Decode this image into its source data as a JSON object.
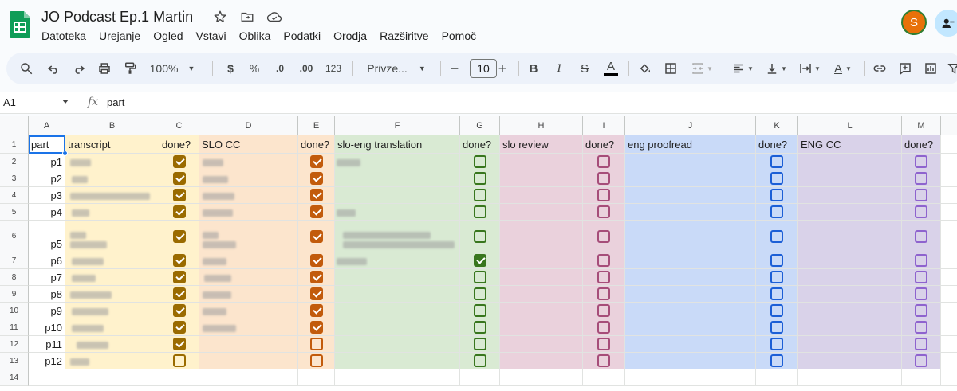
{
  "app": {
    "title": "JO Podcast Ep.1 Martin",
    "menu": [
      "Datoteka",
      "Urejanje",
      "Ogled",
      "Vstavi",
      "Oblika",
      "Podatki",
      "Orodja",
      "Razširitve",
      "Pomoč"
    ],
    "avatar_letter": "S"
  },
  "toolbar": {
    "zoom": "100%",
    "currency": "$",
    "percent": "%",
    "dec_less": ".0",
    "dec_more": ".00",
    "format_123": "123",
    "font": "Privze...",
    "font_size": "10",
    "minus": "−",
    "plus": "+",
    "bold": "B",
    "italic": "I",
    "strike": "S",
    "text_color_letter": "A",
    "text_color_letter2": "A"
  },
  "formula_bar": {
    "name_box": "A1",
    "fx": "fx",
    "value": "part"
  },
  "columns": [
    {
      "letter": "A",
      "width": 46
    },
    {
      "letter": "B",
      "width": 118
    },
    {
      "letter": "C",
      "width": 50
    },
    {
      "letter": "D",
      "width": 124
    },
    {
      "letter": "E",
      "width": 46
    },
    {
      "letter": "F",
      "width": 157
    },
    {
      "letter": "G",
      "width": 50
    },
    {
      "letter": "H",
      "width": 104
    },
    {
      "letter": "I",
      "width": 53
    },
    {
      "letter": "J",
      "width": 164
    },
    {
      "letter": "K",
      "width": 53
    },
    {
      "letter": "L",
      "width": 130
    },
    {
      "letter": "M",
      "width": 49
    },
    {
      "letter": "",
      "width": 30
    }
  ],
  "header_row": [
    "part",
    "transcript",
    "done?",
    "SLO CC",
    "done?",
    "slo-eng translation",
    "done?",
    "slo review",
    "done?",
    "eng proofread",
    "done?",
    "ENG CC",
    "done?"
  ],
  "row_numbers": [
    "1",
    "2",
    "3",
    "4",
    "5",
    "6",
    "7",
    "8",
    "9",
    "10",
    "11",
    "12",
    "13",
    "14"
  ],
  "parts": [
    "p1",
    "p2",
    "p3",
    "p4",
    "p5",
    "p6",
    "p7",
    "p8",
    "p9",
    "p10",
    "p11",
    "p12"
  ],
  "checks": {
    "C": [
      true,
      true,
      true,
      true,
      true,
      true,
      true,
      true,
      true,
      true,
      true,
      false
    ],
    "E": [
      true,
      true,
      true,
      true,
      true,
      true,
      true,
      true,
      true,
      true,
      false,
      false
    ],
    "G": [
      false,
      false,
      false,
      false,
      false,
      true,
      false,
      false,
      false,
      false,
      false,
      false
    ],
    "I": [
      false,
      false,
      false,
      false,
      false,
      false,
      false,
      false,
      false,
      false,
      false,
      false
    ],
    "K": [
      false,
      false,
      false,
      false,
      false,
      false,
      false,
      false,
      false,
      false,
      false,
      false
    ],
    "M": [
      false,
      false,
      false,
      false,
      false,
      false,
      false,
      false,
      false,
      false,
      false,
      false
    ]
  },
  "colors": {
    "transcript_bg": "#fff2cc",
    "slo_cc_bg": "#fce5cd",
    "translation_bg": "#d9ead3",
    "review_bg": "#ead1dc",
    "proofread_bg": "#c9daf8",
    "eng_cc_bg": "#d9d2e9",
    "check_C": "#9a6b00",
    "check_E": "#c25b0c",
    "check_G": "#38761d",
    "check_I": "#a64d79",
    "check_K": "#1c5fd6",
    "check_M": "#8e63ce",
    "sheets_green": "#0f9d58"
  }
}
